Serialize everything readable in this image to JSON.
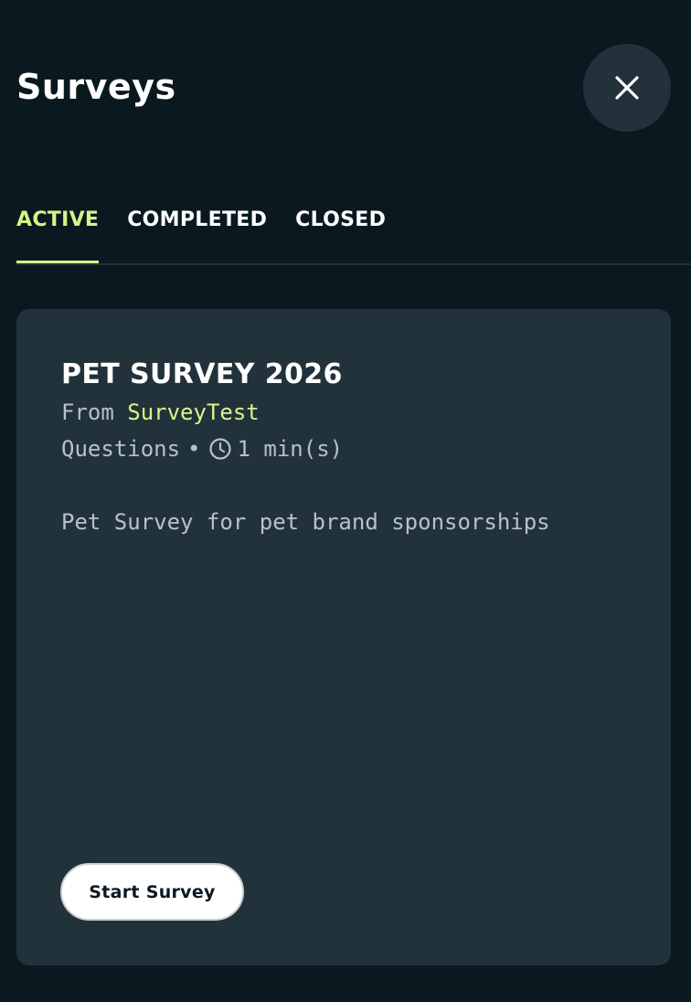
{
  "header": {
    "title": "Surveys",
    "close_icon": "close-icon"
  },
  "tabs": [
    {
      "label": "ACTIVE",
      "selected": true
    },
    {
      "label": "COMPLETED",
      "selected": false
    },
    {
      "label": "CLOSED",
      "selected": false
    }
  ],
  "survey_card": {
    "title": "PET SURVEY 2026",
    "from_label": "From",
    "sender": "SurveyTest",
    "questions_label": "Questions",
    "separator": "•",
    "duration_icon": "clock-icon",
    "duration": "1 min(s)",
    "description": "Pet Survey for pet brand sponsorships",
    "start_button_label": "Start Survey"
  },
  "colors": {
    "background": "#0a1820",
    "card": "#22323b",
    "accent": "#d6f58a",
    "muted_text": "#b6c2c8"
  }
}
